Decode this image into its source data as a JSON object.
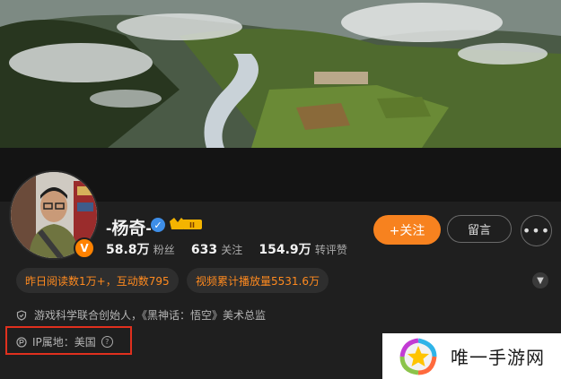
{
  "profile": {
    "name": "-杨奇-",
    "avatar_badge": "V",
    "stats": [
      {
        "value": "58.8万",
        "label": "粉丝"
      },
      {
        "value": "633",
        "label": "关注"
      },
      {
        "value": "154.9万",
        "label": "转评赞"
      }
    ]
  },
  "actions": {
    "follow_label": "+关注",
    "message_label": "留言",
    "more_label": "•••"
  },
  "tags": [
    {
      "text": "昨日阅读数1万+，互动数795"
    },
    {
      "text": "视频累计播放量5531.6万"
    }
  ],
  "description": "游戏科学联合创始人，《黑神话：悟空》美术总监",
  "ip_location": "IP属地：美国",
  "watermark": {
    "text": "唯一手游网"
  },
  "colors": {
    "accent": "#f7821f",
    "tag_text": "#ff8a1f",
    "highlight_box": "#e0301e",
    "verified": "#3e8ee8"
  },
  "icons": [
    "verified-icon",
    "vip-crown-icon",
    "chevron-down-icon",
    "shield-icon",
    "location-icon",
    "help-icon",
    "more-icon"
  ]
}
